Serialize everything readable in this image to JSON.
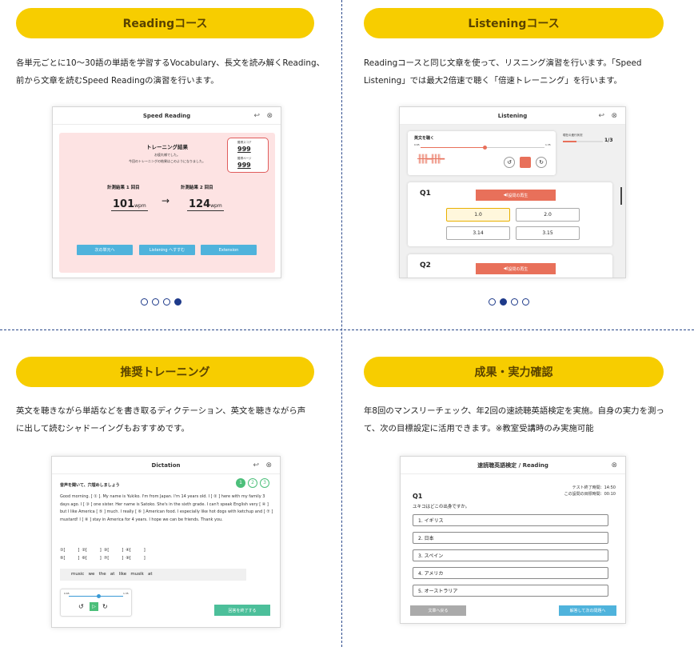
{
  "reading": {
    "title": "Readingコース",
    "desc": "各単元ごとに10〜30語の単語を学習するVocabulary、長文を読み解くReading、\n前から文章を読むSpeed Readingの演習を行います。",
    "shot": {
      "title": "Speed Reading",
      "result_title": "トレーニング結果",
      "msg1": "お疲れ様でした。",
      "msg2": "今回のトレーニングの結果はこのようになりました。",
      "score_label": "獲得スコア",
      "score": "999",
      "page_label": "獲得ページ",
      "page": "999",
      "r1_label": "計測結果 1 回目",
      "r1": "101",
      "r2_label": "計測結果 2 回目",
      "r2": "124",
      "unit": "wpm",
      "arrow": "→",
      "b1": "次の単元へ",
      "b2": "Listening へすすむ",
      "b3": "Extension"
    }
  },
  "listening": {
    "title": "Listeningコース",
    "desc": "Readingコースと同じ文章を使って、リスニング演習を行います。「Speed\nListening」では最大2倍速で聴く「倍速トレーニング」を行います。",
    "shot": {
      "title": "Listening",
      "listen_label": "英文を聴く",
      "speed_min": "0.65",
      "speed_max": "1.35",
      "progress_label": "現在の進行状況",
      "progress": "1/3",
      "progress_value": 0.33,
      "q1": "Q1",
      "q2": "Q2",
      "play_label": "設問の再生",
      "options": [
        "1.0",
        "2.0",
        "3.14",
        "3.15"
      ]
    }
  },
  "dictation": {
    "title": "推奨トレーニング",
    "desc": "英文を聴きながら単語などを書き取るディクテーション、英文を聴きながら声\nに出して読むシャドーイングもおすすめです。",
    "shot": {
      "title": "Dictation",
      "instruction": "音声を聞いて、穴埋めしましょう",
      "steps": [
        "1",
        "2",
        "3"
      ],
      "passage": "Good morning. [ ① ]. My name is Yukiko. I'm from Japan. I'm 14 years old. I [ ② ] here with my family 3 days ago. I [ ③ ] one sister. Her name is Satoko. She's in the sixth grade. I can't speak English very [ ④ ] but I like America [ ⑤ ] much. I really [ ⑥ ] American food. I especially like hot dogs with ketchup and [ ⑦ ] mustard! I [ ⑧ ] stay in America for 4 years. I hope we can be friends. Thank you.",
      "blanks_row1": "①[          ]  ②[          ]  ③[          ]  ④[          ]",
      "blanks_row2": "⑤[          ]  ⑥[          ]  ⑦[          ]  ⑧[          ]",
      "words": "music   we   the   at   like   musik   at",
      "speed_min": "0.65",
      "speed_max": "1.35",
      "finish": "回答を終了する"
    }
  },
  "result": {
    "title": "成果・実力確認",
    "desc": "年8回のマンスリーチェック、年2回の速読聴英語検定を実施。自身の実力を測っ\nて、次の目標設定に活用できます。※教室受講時のみ実施可能",
    "shot": {
      "title": "速読聴英語検定 / Reading",
      "q": "Q1",
      "timer1": "テスト終了時間：14:50",
      "timer2": "この設問の目標時間：00:10",
      "question": "ユキコはどこの出身ですか。",
      "answers": [
        "1. イギリス",
        "2. 日本",
        "3. スペイン",
        "4. アメリカ",
        "5. オーストラリア"
      ],
      "back": "文章へ戻る",
      "next": "解答して次の問題へ"
    }
  },
  "icons": {
    "back": "↩",
    "close": "⊗"
  }
}
